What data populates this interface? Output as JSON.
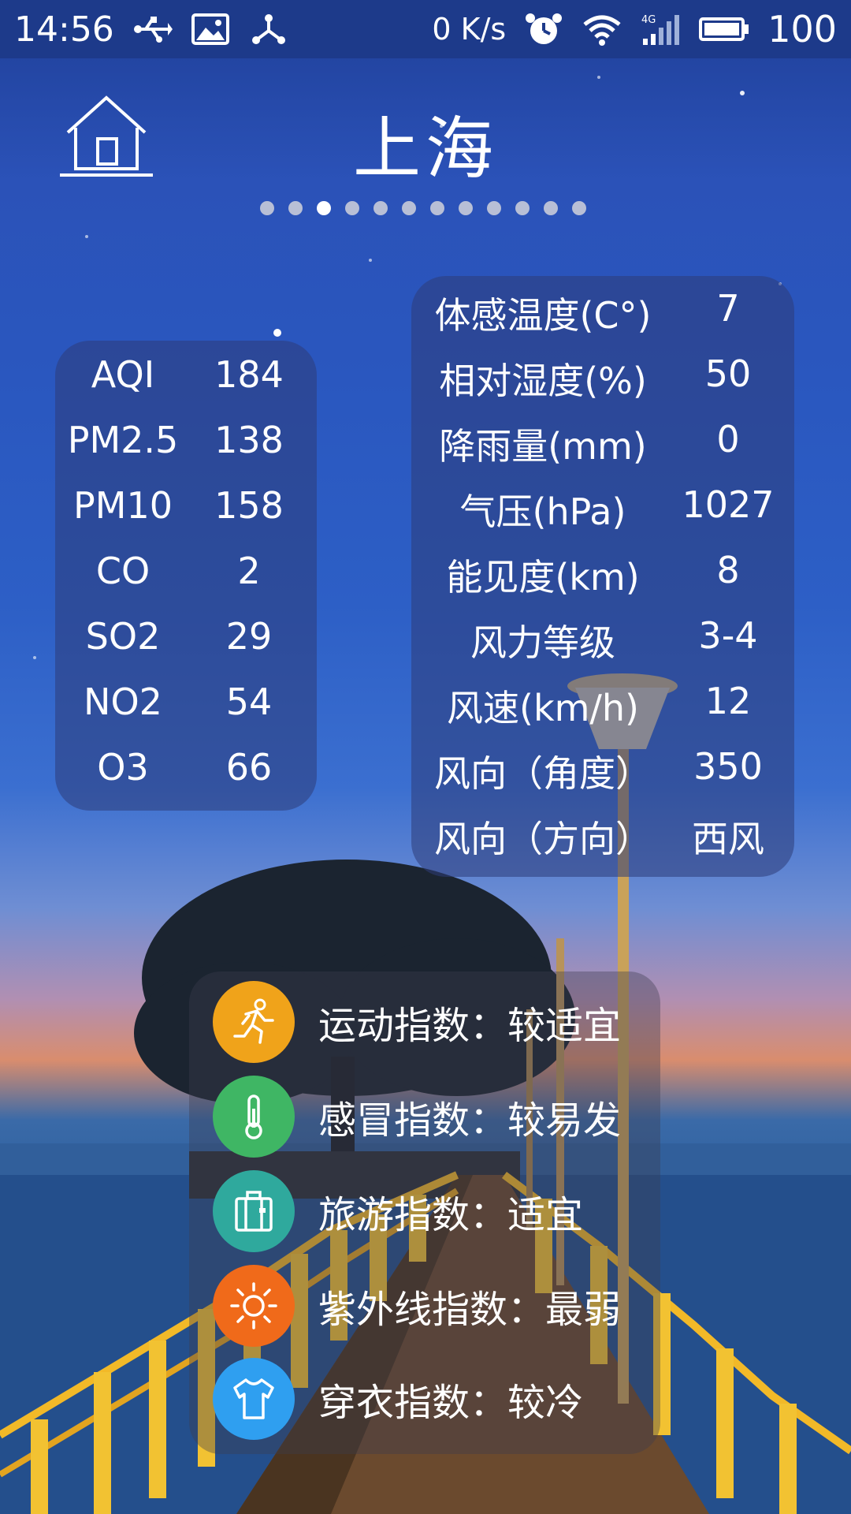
{
  "status_bar": {
    "time": "14:56",
    "net_speed": "0 K/s",
    "battery": "100",
    "icons": [
      "usb-icon",
      "image-icon",
      "share-icon",
      "alarm-icon",
      "wifi-icon",
      "signal-4g-icon",
      "battery-icon"
    ]
  },
  "header": {
    "city": "上海",
    "page_count": 12,
    "active_page": 3
  },
  "air_quality": [
    {
      "label": "AQI",
      "value": "184"
    },
    {
      "label": "PM2.5",
      "value": "138"
    },
    {
      "label": "PM10",
      "value": "158"
    },
    {
      "label": "CO",
      "value": "2"
    },
    {
      "label": "SO2",
      "value": "29"
    },
    {
      "label": "NO2",
      "value": "54"
    },
    {
      "label": "O3",
      "value": "66"
    }
  ],
  "weather": [
    {
      "label": "体感温度(C°)",
      "value": "7"
    },
    {
      "label": "相对湿度(%)",
      "value": "50"
    },
    {
      "label": "降雨量(mm)",
      "value": "0"
    },
    {
      "label": "气压(hPa)",
      "value": "1027"
    },
    {
      "label": "能见度(km)",
      "value": "8"
    },
    {
      "label": "风力等级",
      "value": "3-4"
    },
    {
      "label": "风速(km/h)",
      "value": "12"
    },
    {
      "label": "风向（角度）",
      "value": "350"
    },
    {
      "label": "风向（方向）",
      "value": "西风"
    }
  ],
  "indices": [
    {
      "text": "运动指数：较适宜",
      "icon": "running-icon",
      "color": "#f0a31a"
    },
    {
      "text": "感冒指数：较易发",
      "icon": "thermometer-icon",
      "color": "#3fb664"
    },
    {
      "text": "旅游指数：适宜",
      "icon": "luggage-icon",
      "color": "#2fa99d"
    },
    {
      "text": "紫外线指数：最弱",
      "icon": "sun-icon",
      "color": "#f06a1a"
    },
    {
      "text": "穿衣指数：较冷",
      "icon": "tshirt-icon",
      "color": "#2f9ff0"
    }
  ]
}
